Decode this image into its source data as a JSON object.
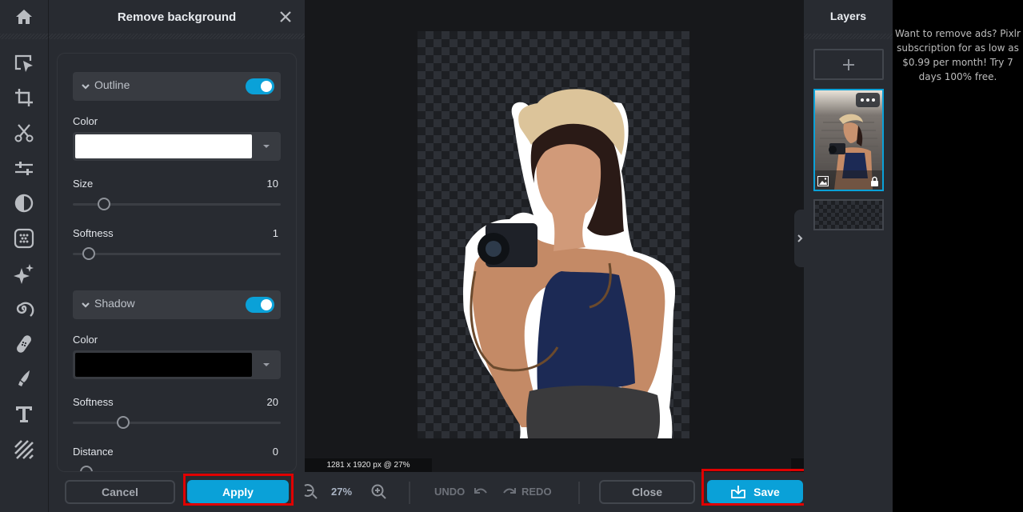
{
  "toolbar": {
    "home_icon": "home-icon",
    "tools": [
      {
        "name": "arrange-tool",
        "icon": "select-arrow-icon"
      },
      {
        "name": "crop-tool",
        "icon": "crop-icon"
      },
      {
        "name": "cutout-tool",
        "icon": "scissors-icon"
      },
      {
        "name": "adjust-tool",
        "icon": "sliders-icon"
      },
      {
        "name": "filter-tool",
        "icon": "contrast-icon"
      },
      {
        "name": "effect-tool",
        "icon": "dots-grid-icon"
      },
      {
        "name": "ai-tool",
        "icon": "sparkle-icon"
      },
      {
        "name": "liquify-tool",
        "icon": "spiral-icon"
      },
      {
        "name": "heal-tool",
        "icon": "bandage-icon"
      },
      {
        "name": "draw-tool",
        "icon": "brush-icon"
      },
      {
        "name": "text-tool",
        "icon": "text-icon"
      },
      {
        "name": "pattern-tool",
        "icon": "stripes-icon"
      }
    ]
  },
  "panel": {
    "title": "Remove background",
    "outline": {
      "label": "Outline",
      "enabled": true,
      "color_label": "Color",
      "color_value": "#ffffff",
      "size_label": "Size",
      "size_value": "10",
      "size_fraction": 0.12,
      "softness_label": "Softness",
      "softness_value": "1",
      "softness_fraction": 0.04
    },
    "shadow": {
      "label": "Shadow",
      "enabled": true,
      "color_label": "Color",
      "color_value": "#000000",
      "softness_label": "Softness",
      "softness_value": "20",
      "softness_fraction": 0.22,
      "distance_label": "Distance",
      "distance_value": "0",
      "distance_fraction": 0.03
    },
    "cancel_label": "Cancel",
    "apply_label": "Apply"
  },
  "canvas": {
    "dimensions_text": "1281 x 1920 px @ 27%"
  },
  "bottombar": {
    "zoom_value": "27%",
    "undo_label": "UNDO",
    "redo_label": "REDO",
    "close_label": "Close",
    "save_label": "Save"
  },
  "layers": {
    "title": "Layers"
  },
  "ad": {
    "text": "Want to remove ads? Pixlr subscription for as low as $0.99 per month! Try 7 days 100% free."
  },
  "colors": {
    "accent": "#0aa1d8",
    "highlight": "#e00000",
    "panel_bg": "#282b31",
    "canvas_bg": "#17181b"
  }
}
